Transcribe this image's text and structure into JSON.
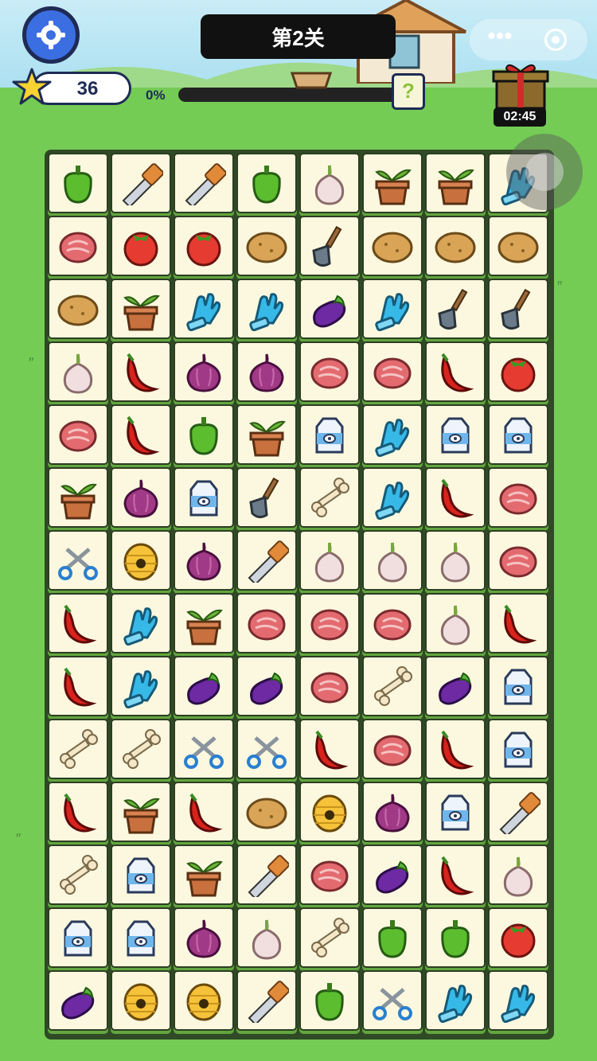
{
  "header": {
    "level_title": "第2关",
    "star_count": "36",
    "progress_label": "0%",
    "progress_value": 0,
    "hint_symbol": "?",
    "timer": "02:45",
    "menu_dots": "•••"
  },
  "icons": {
    "settings": "gear-icon",
    "star": "star-icon",
    "gift": "gift-icon",
    "hint": "question-icon"
  },
  "board": {
    "rows": 14,
    "cols": 8,
    "tiles": [
      [
        "pepper",
        "saw",
        "saw",
        "pepper",
        "garlic",
        "pot",
        "pot",
        "glove"
      ],
      [
        "meat",
        "tomato",
        "tomato",
        "potato",
        "shovel",
        "potato",
        "potato",
        "potato"
      ],
      [
        "potato",
        "pot",
        "glove",
        "glove",
        "eggplant",
        "glove",
        "shovel",
        "shovel"
      ],
      [
        "garlic",
        "chili",
        "onion",
        "onion",
        "meat",
        "meat",
        "chili",
        "tomato"
      ],
      [
        "meat",
        "chili",
        "pepper",
        "pot",
        "milk",
        "glove",
        "milk",
        "milk"
      ],
      [
        "pot",
        "onion",
        "milk",
        "shovel",
        "bone",
        "glove",
        "chili",
        "meat"
      ],
      [
        "scissors",
        "hive",
        "onion",
        "saw",
        "garlic",
        "garlic",
        "garlic",
        "meat"
      ],
      [
        "chili",
        "glove",
        "pot",
        "meat",
        "meat",
        "meat",
        "garlic",
        "chili"
      ],
      [
        "chili",
        "glove",
        "eggplant",
        "eggplant",
        "meat",
        "bone",
        "eggplant",
        "milk"
      ],
      [
        "bone",
        "bone",
        "scissors",
        "scissors",
        "chili",
        "meat",
        "chili",
        "milk"
      ],
      [
        "chili",
        "pot",
        "chili",
        "potato",
        "hive",
        "onion",
        "milk",
        "saw"
      ],
      [
        "bone",
        "milk",
        "pot",
        "saw",
        "meat",
        "eggplant",
        "chili",
        "garlic"
      ],
      [
        "milk",
        "milk",
        "onion",
        "garlic",
        "bone",
        "pepper",
        "pepper",
        "tomato"
      ],
      [
        "eggplant",
        "hive",
        "hive",
        "saw",
        "pepper",
        "scissors",
        "glove",
        "glove"
      ]
    ]
  }
}
